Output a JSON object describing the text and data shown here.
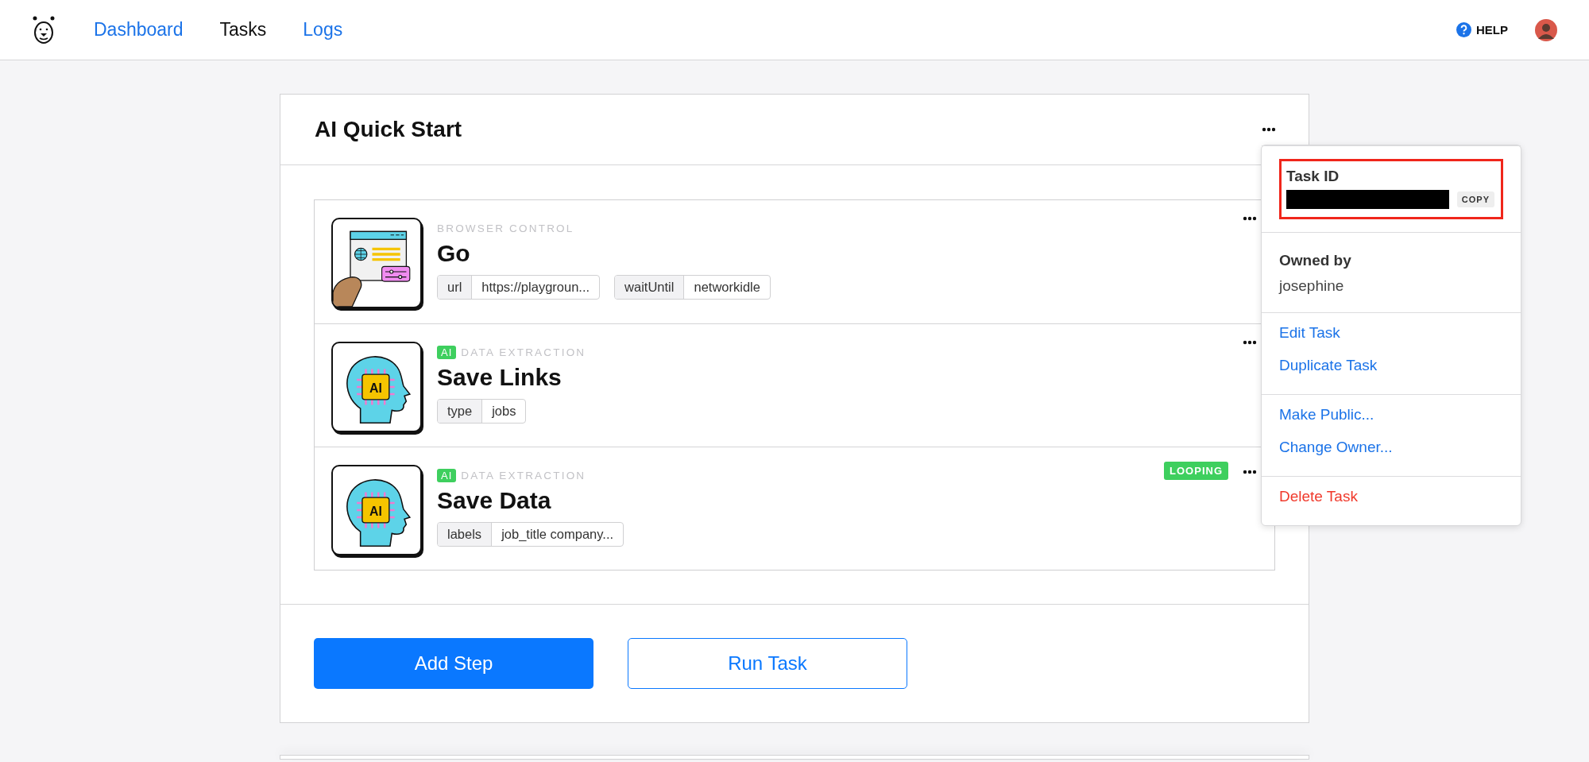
{
  "nav": {
    "items": [
      {
        "label": "Dashboard",
        "selected": false
      },
      {
        "label": "Tasks",
        "selected": true
      },
      {
        "label": "Logs",
        "selected": false
      }
    ],
    "help": "HELP"
  },
  "task": {
    "title": "AI Quick Start",
    "steps": [
      {
        "kind": "browser",
        "category": "BROWSER CONTROL",
        "title": "Go",
        "params": [
          {
            "key": "url",
            "value": "https://playgroun..."
          },
          {
            "key": "waitUntil",
            "value": "networkidle"
          }
        ]
      },
      {
        "kind": "ai",
        "ai_badge": "AI",
        "chip_label": "AI",
        "category": "DATA EXTRACTION",
        "title": "Save Links",
        "params": [
          {
            "key": "type",
            "value": "jobs"
          }
        ]
      },
      {
        "kind": "ai",
        "ai_badge": "AI",
        "chip_label": "AI",
        "category": "DATA EXTRACTION",
        "title": "Save Data",
        "badge": "LOOPING",
        "params": [
          {
            "key": "labels",
            "value": "job_title company..."
          }
        ]
      }
    ],
    "actions": [
      {
        "label": "Add Step",
        "kind": "primary"
      },
      {
        "label": "Run Task",
        "kind": "outline"
      }
    ]
  },
  "menu": {
    "sections": [
      {
        "kind": "id",
        "label": "Task ID",
        "button": "COPY"
      },
      {
        "kind": "owner",
        "label": "Owned by",
        "value": "josephine"
      },
      {
        "kind": "links",
        "items": [
          {
            "label": "Edit Task",
            "kind": "normal"
          },
          {
            "label": "Duplicate Task",
            "kind": "normal"
          }
        ]
      },
      {
        "kind": "links",
        "items": [
          {
            "label": "Make Public...",
            "kind": "normal"
          },
          {
            "label": "Change Owner...",
            "kind": "normal"
          }
        ]
      },
      {
        "kind": "links",
        "items": [
          {
            "label": "Delete Task",
            "kind": "danger"
          }
        ]
      }
    ]
  }
}
